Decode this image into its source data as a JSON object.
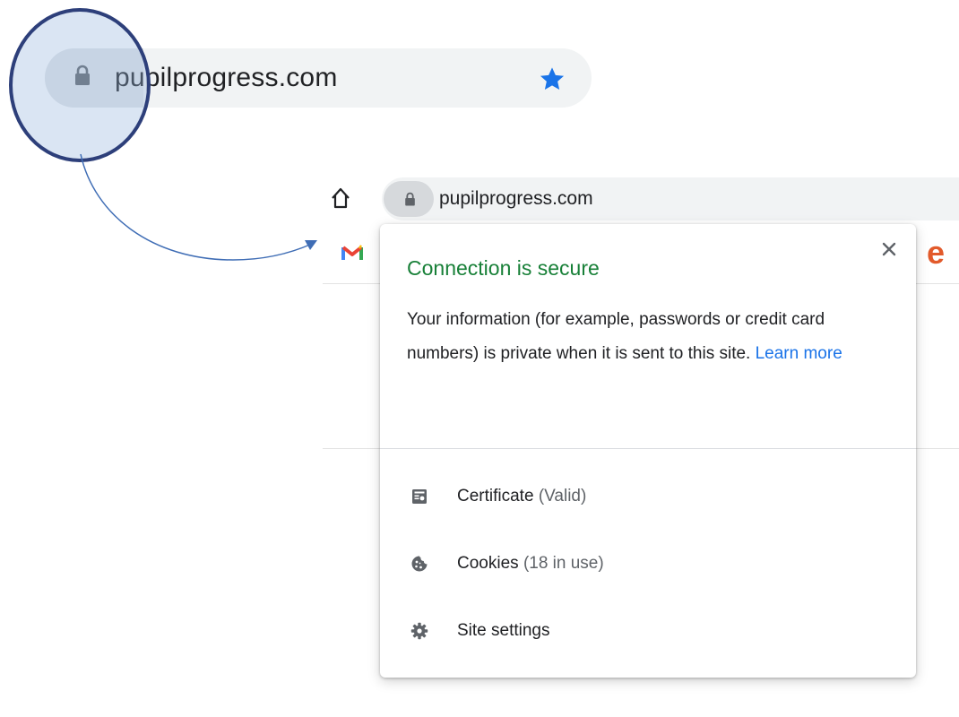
{
  "zoom": {
    "url": "pupilprogress.com",
    "bookmarked": true
  },
  "browser": {
    "url": "pupilprogress.com"
  },
  "popup": {
    "title": "Connection is secure",
    "description": "Your information (for example, passwords or credit card numbers) is private when it is sent to this site.",
    "learn_more": "Learn more",
    "items": [
      {
        "label": "Certificate",
        "sub": "(Valid)",
        "icon": "certificate-icon"
      },
      {
        "label": "Cookies",
        "sub": "(18 in use)",
        "icon": "cookie-icon"
      },
      {
        "label": "Site settings",
        "sub": "",
        "icon": "gear-icon"
      }
    ]
  },
  "colors": {
    "secure_green": "#188038",
    "link_blue": "#1a73e8",
    "star_blue": "#1a73e8",
    "magnifier_border": "#2d3f7a",
    "arrow_blue": "#3f6db5"
  }
}
